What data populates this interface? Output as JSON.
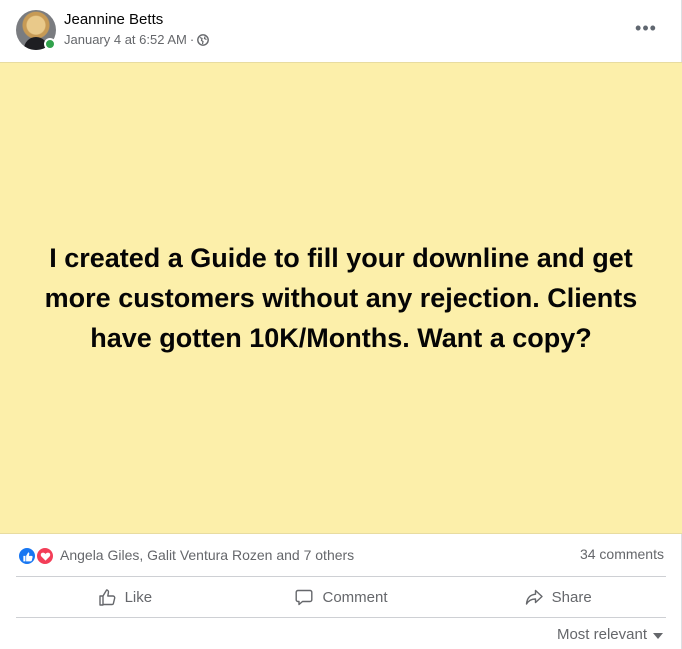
{
  "post": {
    "author": "Jeannine Betts",
    "timestamp": "January 4 at 6:52 AM",
    "separator": "·",
    "audience_icon": "globe-icon",
    "more_label": "•••",
    "body_text": "I created a Guide to fill your downline and get more customers without any rejection. Clients have gotten 10K/Months. Want a copy?",
    "background_color": "#fcefaa"
  },
  "reactions": {
    "icons": [
      "like-reaction-icon",
      "love-reaction-icon"
    ],
    "names": "Angela Giles, Galit Ventura Rozen and 7 others",
    "comments": "34 comments"
  },
  "actions": {
    "like": "Like",
    "comment": "Comment",
    "share": "Share"
  },
  "sort": {
    "label": "Most relevant"
  },
  "colors": {
    "accent": "#1877f2",
    "love": "#f33e58",
    "online": "#31a24c",
    "secondary_text": "#65676b"
  }
}
